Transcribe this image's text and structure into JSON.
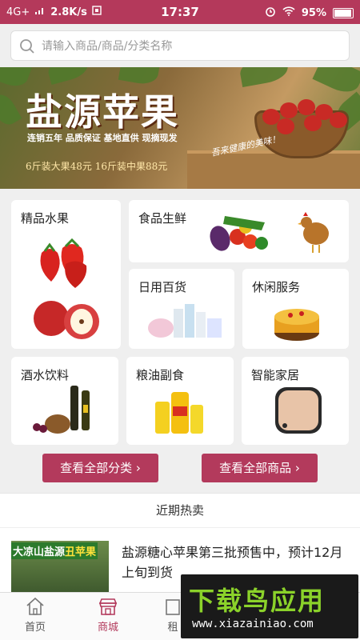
{
  "status_bar": {
    "network": "4G+",
    "speed": "2.8K/s",
    "time": "17:37",
    "battery": "95%"
  },
  "search": {
    "placeholder": "请输入商品/商品/分类名称"
  },
  "banner": {
    "title": "盐源苹果",
    "tags": "连销五年  品质保证  基地直供  现摘现发",
    "promo": "6斤装大果48元    16斤装中果88元",
    "script": "吾来健康的美味！",
    "seal": "盐源"
  },
  "categories": [
    {
      "label": "精品水果"
    },
    {
      "label": "食品生鲜"
    },
    {
      "label": "日用百货"
    },
    {
      "label": "休闲服务"
    },
    {
      "label": "酒水饮料"
    },
    {
      "label": "粮油副食"
    },
    {
      "label": "智能家居"
    }
  ],
  "buttons": {
    "all_categories": "查看全部分类",
    "all_products": "查看全部商品"
  },
  "hot": {
    "header": "近期热卖",
    "items": [
      {
        "badge_prefix": "大凉山盐源",
        "badge_highlight": "丑苹果",
        "title": "盐源糖心苹果第三批预售中，预计12月上旬到货"
      }
    ]
  },
  "tabbar": {
    "items": [
      {
        "label": "首页"
      },
      {
        "label": "商城"
      },
      {
        "label": "租"
      }
    ]
  },
  "watermark": {
    "brand": "下载鸟应用",
    "url": "www.xiazainiao.com"
  },
  "colors": {
    "accent": "#b33a5c",
    "status_bar": "#b4395b",
    "watermark_green": "#8bd22a"
  }
}
